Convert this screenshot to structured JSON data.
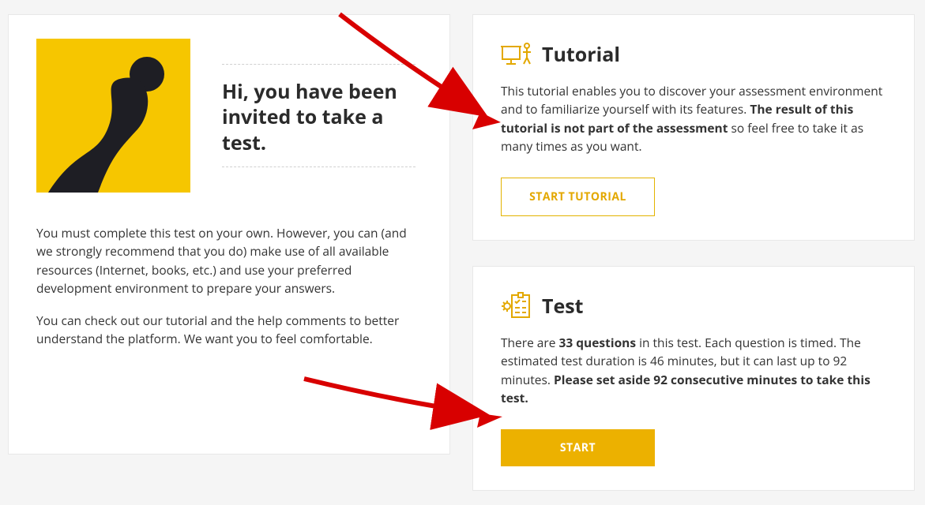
{
  "intro": {
    "heading": "Hi, you have been invited to take a test.",
    "para1": "You must complete this test on your own. However, you can (and we strongly recommend that you do) make use of all available resources (Internet, books, etc.) and use your preferred development environment to prepare your answers.",
    "para2": "You can check out our tutorial and the help comments to better understand the platform. We want you to feel comfortable."
  },
  "tutorial": {
    "title": "Tutorial",
    "desc_pre": "This tutorial enables you to discover your assessment environment and to familiarize yourself with its features. ",
    "desc_bold": "The result of this tutorial is not part of the assessment",
    "desc_post": " so feel free to take it as many times as you want.",
    "button": "START TUTORIAL"
  },
  "test": {
    "title": "Test",
    "question_count": "33 questions",
    "desc_pre": "There are ",
    "desc_mid": " in this test. Each question is timed. The estimated test duration is 46 minutes, but it can last up to 92 minutes. ",
    "desc_bold": "Please set aside 92 consecutive minutes to take this test.",
    "button": "START"
  }
}
